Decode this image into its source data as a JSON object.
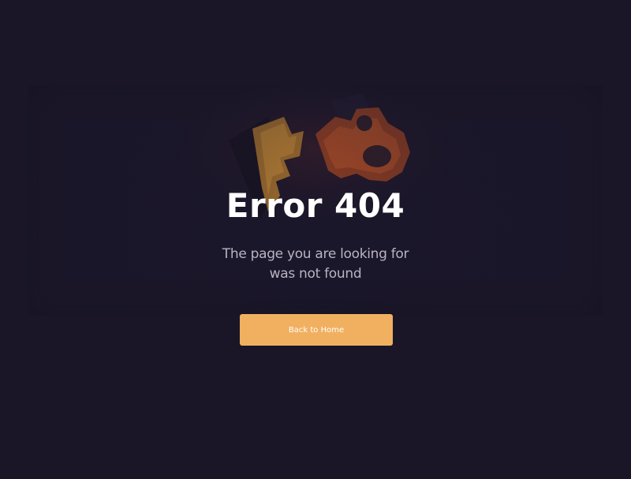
{
  "error": {
    "title": "Error 404",
    "message_line_1": "The page you are looking for",
    "message_line_2": "was not found"
  },
  "actions": {
    "home_button_label": "Back to Home"
  },
  "illustration": {
    "icon": "broken-gear-icon"
  },
  "colors": {
    "background": "#1a1628",
    "accent": "#f1b05f",
    "gear_orange": "#e8733a",
    "gear_yellow": "#f2a93a",
    "title": "#ffffff",
    "subtitle": "#b8b4c2"
  }
}
